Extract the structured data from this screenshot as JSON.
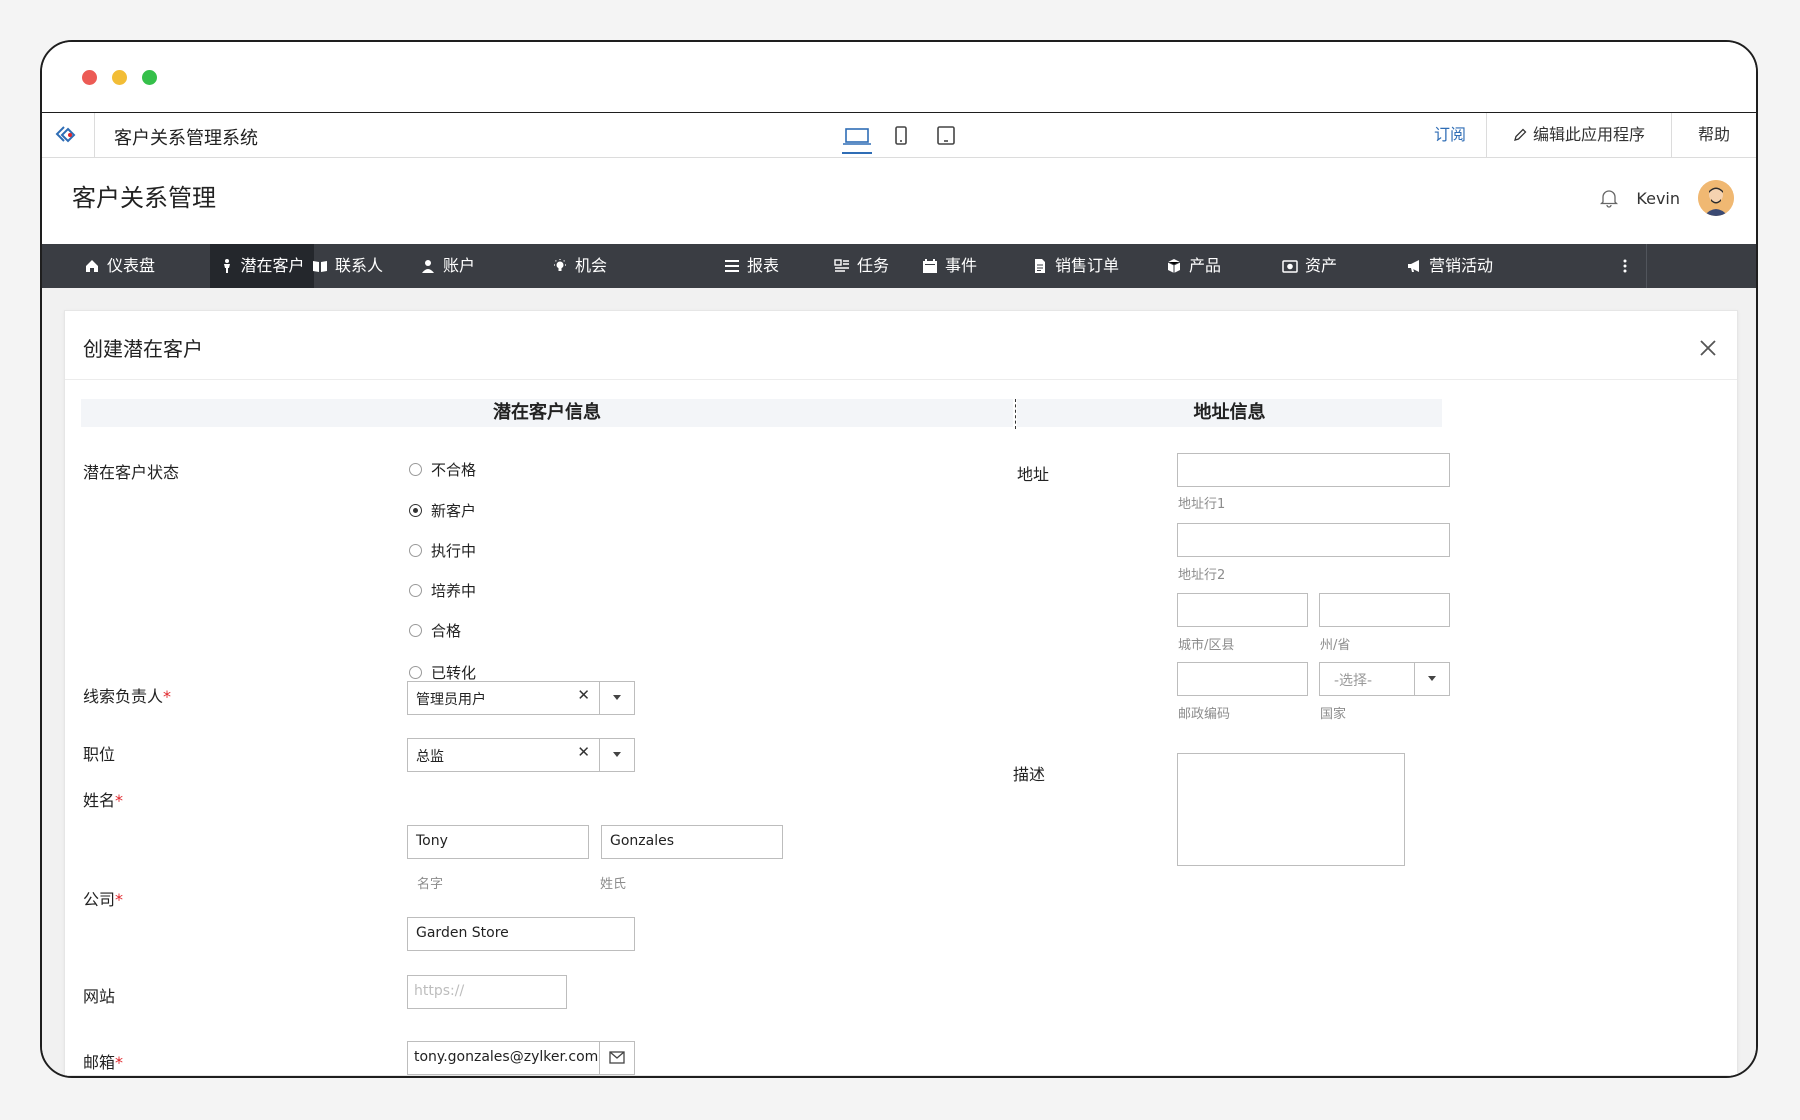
{
  "app": {
    "name": "客户关系管理系统"
  },
  "appbar": {
    "subscribe": "订阅",
    "edit_app": "编辑此应用程序",
    "help": "帮助"
  },
  "header": {
    "title": "客户关系管理",
    "user": "Kevin"
  },
  "nav": [
    {
      "label": "仪表盘",
      "icon": "home-icon"
    },
    {
      "label": "潜在客户",
      "icon": "person-icon",
      "active": true
    },
    {
      "label": "联系人",
      "icon": "book-icon"
    },
    {
      "label": "账户",
      "icon": "user-icon"
    },
    {
      "label": "机会",
      "icon": "bulb-icon"
    },
    {
      "label": "报表",
      "icon": "list-icon"
    },
    {
      "label": "任务",
      "icon": "tasks-icon"
    },
    {
      "label": "事件",
      "icon": "calendar-icon"
    },
    {
      "label": "销售订单",
      "icon": "document-icon"
    },
    {
      "label": "产品",
      "icon": "box-icon"
    },
    {
      "label": "资产",
      "icon": "camera-icon"
    },
    {
      "label": "营销活动",
      "icon": "megaphone-icon"
    }
  ],
  "form": {
    "title": "创建潜在客户",
    "sections": {
      "left": "潜在客户信息",
      "right": "地址信息"
    },
    "status": {
      "label": "潜在客户状态",
      "options": [
        "不合格",
        "新客户",
        "执行中",
        "培养中",
        "合格",
        "已转化"
      ],
      "selected": "新客户"
    },
    "owner": {
      "label": "线索负责人",
      "required": "*",
      "value": "管理员用户"
    },
    "position": {
      "label": "职位",
      "value": "总监"
    },
    "name": {
      "label": "姓名",
      "required": "*",
      "first": "Tony",
      "last": "Gonzales",
      "first_hint": "名字",
      "last_hint": "姓氏"
    },
    "company": {
      "label": "公司",
      "required": "*",
      "value": "Garden Store"
    },
    "website": {
      "label": "网站",
      "placeholder": "https://"
    },
    "email": {
      "label": "邮箱",
      "required": "*",
      "value": "tony.gonzales@zylker.com"
    },
    "address": {
      "label": "地址",
      "line1": "地址行1",
      "line2": "地址行2",
      "city": "城市/区县",
      "state": "州/省",
      "zip": "邮政编码",
      "country": "国家",
      "country_placeholder": "-选择-"
    },
    "description": {
      "label": "描述"
    }
  },
  "colors": {
    "nav_bg": "#3a3d43",
    "nav_active": "#24272c",
    "accent": "#2f6db5",
    "required": "#e0262b"
  }
}
